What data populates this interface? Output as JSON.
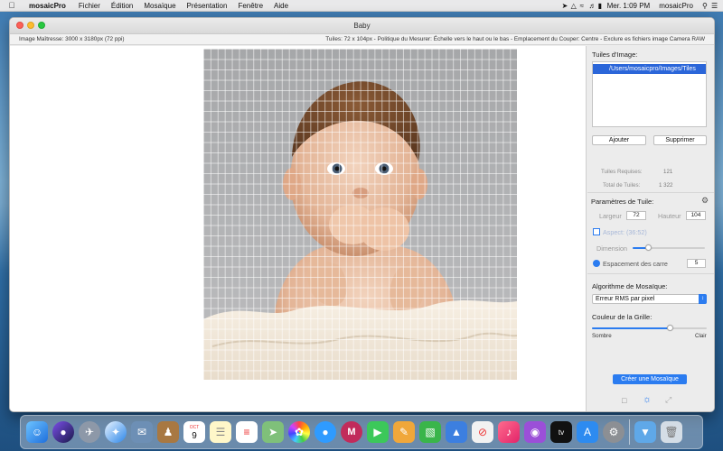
{
  "menubar": {
    "app_name": "mosaicPro",
    "menus": [
      "Fichier",
      "Édition",
      "Mosaïque",
      "Présentation",
      "Fenêtre",
      "Aide"
    ],
    "clock": "Mer. 1:09 PM",
    "user": "mosaicPro"
  },
  "window": {
    "title": "Baby"
  },
  "infobar": {
    "left": "Image Maîtresse: 3000 x 3180px (72 ppi)",
    "right": "Tuiles: 72 x 104px  -  Politique du Mesurer: Échelle vers le haut ou le bas  -  Emplacement du Couper: Centre - Exclure es fichiers image Camera RAW"
  },
  "sidebar": {
    "tiles_label": "Tuiles d'Image:",
    "tiles_list": [
      "/Users/mosaicpro/Images/Tiles"
    ],
    "add_button": "Ajouter",
    "remove_button": "Supprimer",
    "tiles_required_label": "Tuiles Requises:",
    "tiles_required_value": "121",
    "tiles_total_label": "Total de Tuiles:",
    "tiles_total_value": "1 322",
    "tile_params_label": "Paramètres de Tuile:",
    "width_label": "Largeur",
    "width_value": "72",
    "height_label": "Hauteur",
    "height_value": "104",
    "aspect_label": "Aspect: (36:52)",
    "dimension_label": "Dimension",
    "dimension_level": 0.22,
    "spacing_label": "Espacement des carre",
    "spacing_value": "5",
    "algorithm_label": "Algorithme de Mosaïque:",
    "algorithm_value": "Erreur RMS par pixel",
    "grid_color_label": "Couleur de la Grille:",
    "grid_color_level": 0.68,
    "dark_label": "Sombre",
    "light_label": "Clair",
    "create_button": "Créer une Mosaïque"
  },
  "colors": {
    "accent": "#2b7cf0",
    "selection": "#2b66d9",
    "close": "#fc5f57",
    "minimize": "#fdbc2e",
    "maximize": "#28c840"
  },
  "dock": {
    "calendar_day": "9",
    "calendar_month": "OCT"
  }
}
